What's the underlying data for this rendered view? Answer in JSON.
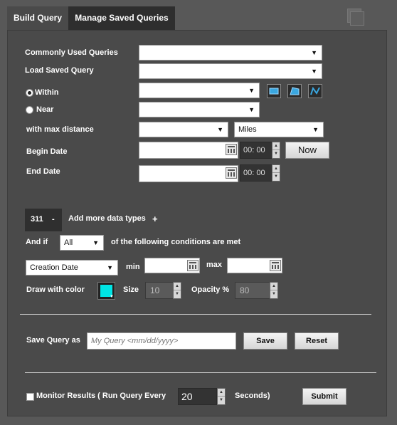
{
  "tabs": {
    "build": "Build Query",
    "manage": "Manage Saved Queries"
  },
  "labels": {
    "commonly_used": "Commonly Used Queries",
    "load_saved": "Load Saved Query",
    "within": "Within",
    "near": "Near",
    "max_distance": "with max distance",
    "begin_date": "Begin Date",
    "end_date": "End Date",
    "add_more": "Add more data types",
    "and_if": "And if",
    "conditions": "of the following conditions are met",
    "min": "min",
    "max": "max",
    "draw_color": "Draw with color",
    "size": "Size",
    "opacity": "Opacity %",
    "save_query_as": "Save Query as",
    "monitor": "Monitor Results ( Run Query Every",
    "seconds": "Seconds)"
  },
  "fields": {
    "distance_unit": "Miles",
    "begin_hour": "00",
    "begin_min": "00",
    "end_hour": "00",
    "end_min": "00",
    "data_type_count": "311",
    "minus": "-",
    "plus": "+",
    "condition_match": "All",
    "condition_field": "Creation Date",
    "size_value": "10",
    "opacity_value": "80",
    "query_name_placeholder": "My Query <mm/dd/yyyy>",
    "monitor_seconds": "20"
  },
  "buttons": {
    "now": "Now",
    "save": "Save",
    "reset": "Reset",
    "submit": "Submit"
  },
  "colors": {
    "draw_color": "#00e5e5",
    "shape_icon": "#3aa7e0"
  },
  "icons": [
    "rectangle-icon",
    "polygon-icon",
    "polyline-icon",
    "calendar-icon",
    "layers-icon"
  ]
}
